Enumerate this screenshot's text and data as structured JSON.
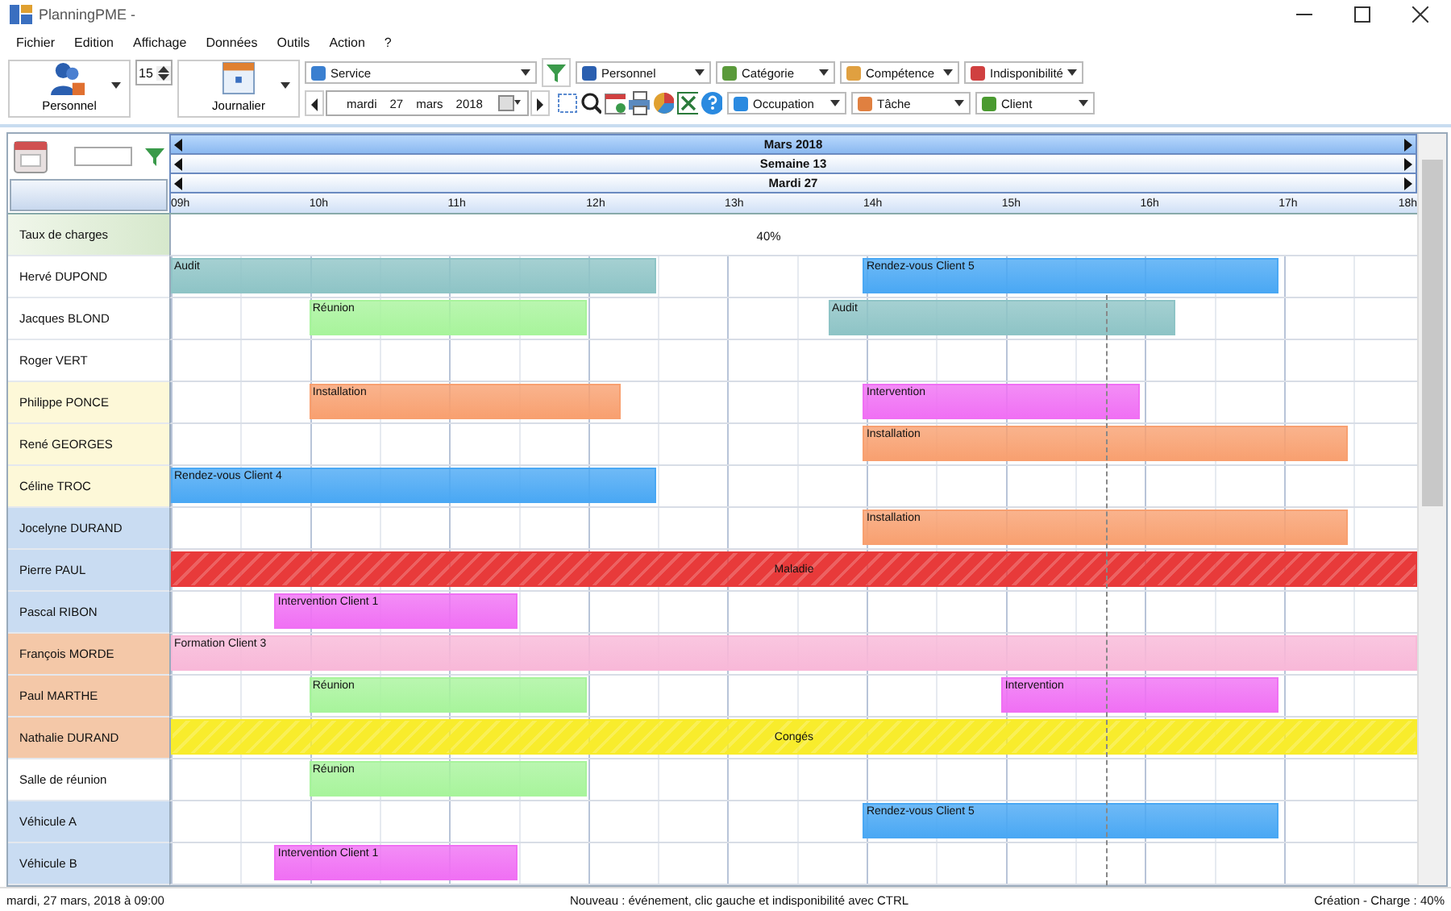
{
  "window": {
    "title": "PlanningPME -"
  },
  "menu": [
    "Fichier",
    "Edition",
    "Affichage",
    "Données",
    "Outils",
    "Action",
    "?"
  ],
  "toolbar": {
    "view_button": "Personnel",
    "spinner": "15",
    "mode_button": "Journalier",
    "row1": [
      {
        "kind": "service",
        "label": "Service"
      },
      {
        "kind": "personnel",
        "label": "Personnel"
      },
      {
        "kind": "category",
        "label": "Catégorie"
      },
      {
        "kind": "skill",
        "label": "Compétence"
      },
      {
        "kind": "unavailable",
        "label": "Indisponibilité"
      }
    ],
    "date": {
      "weekday": "mardi",
      "day": "27",
      "month": "mars",
      "year": "2018"
    },
    "row2": [
      {
        "kind": "occupation",
        "label": "Occupation"
      },
      {
        "kind": "task",
        "label": "Tâche"
      },
      {
        "kind": "client",
        "label": "Client"
      }
    ]
  },
  "header": {
    "month": "Mars 2018",
    "week": "Semaine 13",
    "day": "Mardi 27",
    "hours": [
      "09h",
      "10h",
      "11h",
      "12h",
      "13h",
      "14h",
      "15h",
      "16h",
      "17h",
      "18h"
    ]
  },
  "load": {
    "label": "Taux de charges",
    "value": "40%"
  },
  "rows": [
    {
      "name": "Hervé DUPOND",
      "color": "#ffffff",
      "events": [
        {
          "kind": "task",
          "label": "Audit",
          "color": "#8ec4c6"
        },
        {
          "kind": "task",
          "label": "Rendez-vous Client 5",
          "color": "#4aa8f4"
        }
      ]
    },
    {
      "name": "Jacques BLOND",
      "color": "#ffffff",
      "events": [
        {
          "kind": "task",
          "label": "Réunion",
          "color": "#a8f49c"
        },
        {
          "kind": "task",
          "label": "Audit",
          "color": "#8ec4c6"
        }
      ]
    },
    {
      "name": "Roger VERT",
      "color": "#ffffff"
    },
    {
      "name": "Philippe PONCE",
      "color": "#fdf8d8",
      "events": [
        {
          "kind": "task",
          "label": "Installation",
          "color": "#f8a070"
        },
        {
          "kind": "task",
          "label": "Intervention",
          "color": "#f070f4"
        }
      ]
    },
    {
      "name": "René GEORGES",
      "color": "#fdf8d8",
      "events": [
        {
          "kind": "task",
          "label": "Installation",
          "color": "#f8a070"
        }
      ]
    },
    {
      "name": "Céline TROC",
      "color": "#fdf8d8",
      "events": [
        {
          "kind": "task",
          "label": "Rendez-vous Client 4",
          "color": "#4aa8f4"
        }
      ]
    },
    {
      "name": "Jocelyne DURAND",
      "color": "#c9dcf2",
      "events": [
        {
          "kind": "task",
          "label": "Installation",
          "color": "#f8a070"
        }
      ]
    },
    {
      "name": "Pierre PAUL",
      "color": "#c9dcf2",
      "events": [
        {
          "kind": "absence",
          "label": "Maladie",
          "color": "#e83a3a"
        }
      ]
    },
    {
      "name": "Pascal RIBON",
      "color": "#c9dcf2",
      "events": [
        {
          "kind": "task",
          "label": "Intervention Client 1",
          "color": "#f070f4"
        }
      ]
    },
    {
      "name": "François MORDE",
      "color": "#f4c8a8",
      "events": [
        {
          "kind": "task",
          "label": "Formation Client 3",
          "color": "#f8b8d8"
        }
      ]
    },
    {
      "name": "Paul MARTHE",
      "color": "#f4c8a8",
      "events": [
        {
          "kind": "task",
          "label": "Réunion",
          "color": "#a8f49c"
        },
        {
          "kind": "task",
          "label": "Intervention",
          "color": "#f070f4"
        }
      ]
    },
    {
      "name": "Nathalie DURAND",
      "color": "#f4c8a8",
      "events": [
        {
          "kind": "absence",
          "label": "Congés",
          "color": "#f8ec2c"
        }
      ]
    },
    {
      "name": "Salle de réunion",
      "color": "#ffffff",
      "events": [
        {
          "kind": "task",
          "label": "Réunion",
          "color": "#a8f49c"
        }
      ]
    },
    {
      "name": "Véhicule A",
      "color": "#c9dcf2",
      "events": [
        {
          "kind": "task",
          "label": "Rendez-vous Client 5",
          "color": "#4aa8f4"
        }
      ]
    },
    {
      "name": "Véhicule B",
      "color": "#c9dcf2",
      "events": [
        {
          "kind": "task",
          "label": "Intervention Client 1",
          "color": "#f070f4"
        }
      ]
    }
  ],
  "status_bar": {
    "left": "mardi, 27 mars, 2018 à 09:00",
    "center": "Nouveau : événement, clic gauche et indisponibilité avec CTRL",
    "right": "Création - Charge : 40%"
  }
}
